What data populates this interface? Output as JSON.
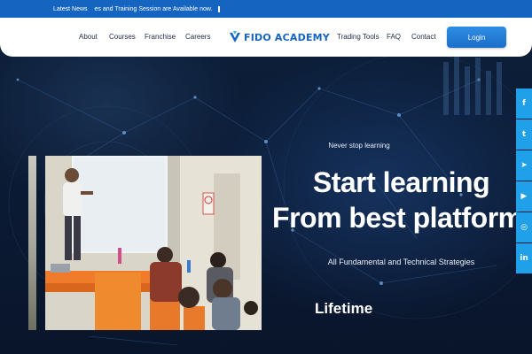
{
  "ticker": {
    "label": "Latest News",
    "text": "es and Training Session are Available now."
  },
  "nav": {
    "left": [
      "About",
      "Courses",
      "Franchise",
      "Careers"
    ],
    "right": [
      "Trading Tools",
      "FAQ",
      "Contact"
    ],
    "login_label": "Login"
  },
  "logo": {
    "text": "FIDO ACADEMY"
  },
  "hero": {
    "tagline": "Never stop learning",
    "headline_line1": "Start learning",
    "headline_line2": "From best platform.",
    "subline": "All Fundamental and Technical Strategies",
    "lifetime": "Lifetime"
  },
  "social": [
    {
      "icon": "facebook-icon",
      "glyph": "f"
    },
    {
      "icon": "twitter-icon",
      "glyph": "t"
    },
    {
      "icon": "telegram-icon",
      "glyph": "➤"
    },
    {
      "icon": "youtube-icon",
      "glyph": "▶"
    },
    {
      "icon": "instagram-icon",
      "glyph": "◎"
    },
    {
      "icon": "linkedin-icon",
      "glyph": "in"
    }
  ],
  "colors": {
    "ticker_bg": "#1565c0",
    "brand_blue": "#1565c0",
    "login_bg": "#2f8de4",
    "social_bg": "#1fa0e8",
    "hero_bg": "#0a1a33"
  }
}
